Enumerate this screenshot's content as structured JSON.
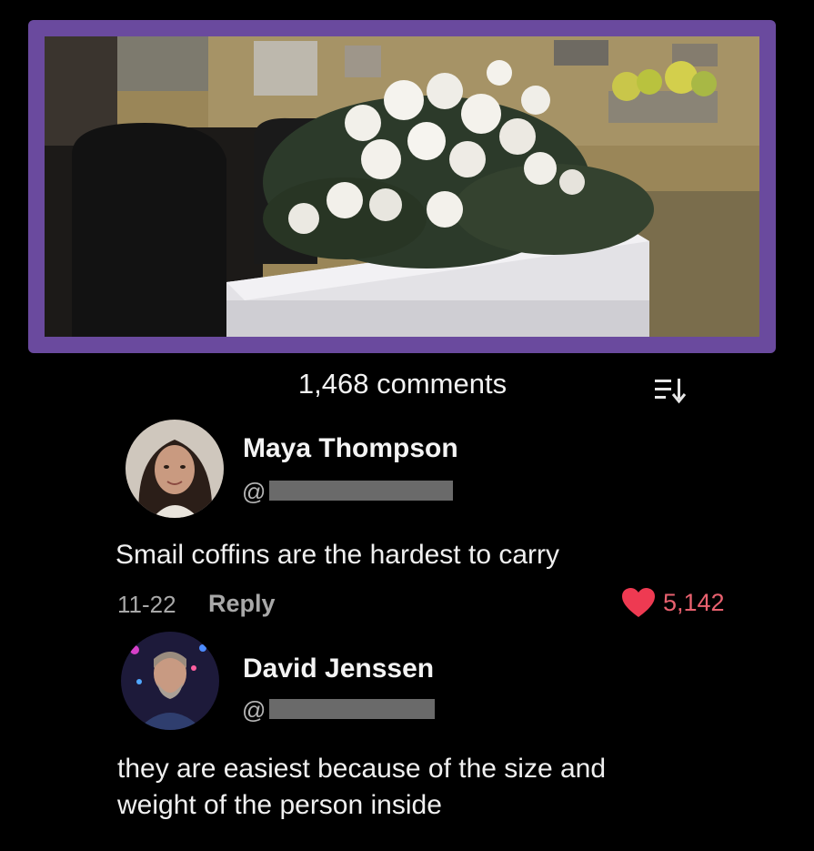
{
  "header": {
    "comments_count": "1,468 comments"
  },
  "comments": [
    {
      "author": "Maya Thompson",
      "handle_prefix": "@",
      "text": "Smail coffins are the hardest to carry",
      "date": "11-22",
      "reply_label": "Reply",
      "likes": "5,142"
    },
    {
      "author": "David Jenssen",
      "handle_prefix": "@",
      "text_line1": "they are easiest because of the size and",
      "text_line2": "weight of the person inside"
    }
  ],
  "colors": {
    "frame": "#6a4a9e",
    "like": "#e8616f",
    "heart": "#ee3a52"
  },
  "icons": {
    "sort": "sort-descending-icon",
    "like": "heart-icon"
  }
}
